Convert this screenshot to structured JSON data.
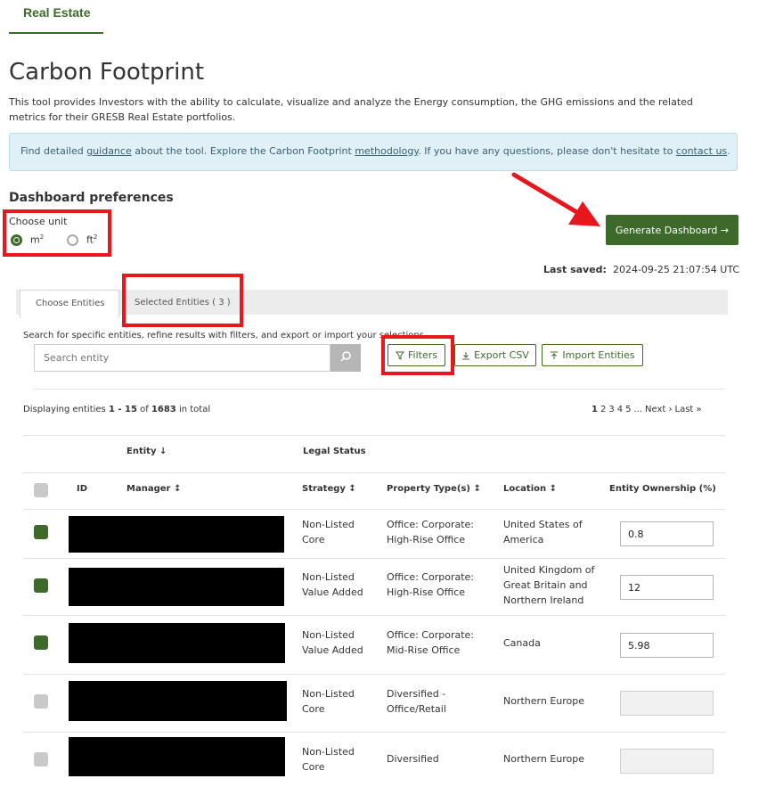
{
  "nav": {
    "tab_label": "Real Estate"
  },
  "page": {
    "title": "Carbon Footprint",
    "description": "This tool provides Investors with the ability to calculate, visualize and analyze the Energy consumption, the GHG emissions and the related metrics for their GRESB Real Estate portfolios.",
    "info": {
      "t1": "Find detailed ",
      "link_guidance": "guidance",
      "t2": " about the tool. Explore the Carbon Footprint ",
      "link_methodology": "methodology",
      "t3": ". If you have any questions, please don't hesitate to ",
      "link_contact": "contact us",
      "t4": "."
    }
  },
  "preferences": {
    "title": "Dashboard preferences",
    "unit_label": "Choose unit",
    "unit_m_base": "m",
    "unit_ft_base": "ft",
    "unit_exp": "2",
    "selected_unit": "m2"
  },
  "generate_button": {
    "label": "Generate Dashboard →"
  },
  "last_saved": {
    "label": "Last saved:",
    "value": "2024-09-25 21:07:54 UTC"
  },
  "tabs": [
    {
      "label": "Choose Entities",
      "active": true
    },
    {
      "label": "Selected Entities ( 3 )",
      "active": false
    }
  ],
  "search": {
    "hint": "Search for specific entities, refine results with filters, and export or import your selections",
    "placeholder": "Search entity"
  },
  "toolbar": {
    "filters_label": "Filters",
    "export_label": "Export CSV",
    "import_label": "Import Entities"
  },
  "display": {
    "prefix": "Displaying entities ",
    "range": "1 - 15",
    "mid": " of ",
    "total": "1683",
    "suffix": " in total"
  },
  "pagination": {
    "pages": [
      "1",
      "2",
      "3",
      "4",
      "5"
    ],
    "current": "1",
    "ellipsis": "...",
    "next": "Next ›",
    "last": "Last »"
  },
  "table": {
    "group_headers": {
      "entity": "Entity",
      "legal_status": "Legal Status"
    },
    "headers": {
      "id": "ID",
      "manager": "Manager",
      "strategy": "Strategy",
      "property_types": "Property Type(s)",
      "location": "Location",
      "ownership": "Entity Ownership (%)"
    },
    "rows": [
      {
        "checked": true,
        "strategy": [
          "Non-Listed",
          "Core"
        ],
        "property": [
          "Office: Corporate:",
          "High-Rise Office"
        ],
        "location": [
          "United States of",
          "America"
        ],
        "ownership": "0.8"
      },
      {
        "checked": true,
        "strategy": [
          "Non-Listed",
          "Value Added"
        ],
        "property": [
          "Office: Corporate:",
          "High-Rise Office"
        ],
        "location": [
          "United Kingdom of",
          "Great Britain and",
          "Northern Ireland"
        ],
        "ownership": "12"
      },
      {
        "checked": true,
        "strategy": [
          "Non-Listed",
          "Value Added"
        ],
        "property": [
          "Office: Corporate:",
          "Mid-Rise Office"
        ],
        "location": [
          "Canada"
        ],
        "ownership": "5.98"
      },
      {
        "checked": false,
        "strategy": [
          "Non-Listed",
          "Core"
        ],
        "property": [
          "Diversified -",
          "Office/Retail"
        ],
        "location": [
          "Northern Europe"
        ],
        "ownership": ""
      },
      {
        "checked": false,
        "strategy": [
          "Non-Listed",
          "Core"
        ],
        "property": [
          "Diversified"
        ],
        "location": [
          "Northern Europe"
        ],
        "ownership": ""
      }
    ]
  },
  "colors": {
    "brand": "#3d6a2a",
    "highlight": "#e8171d",
    "info_bg": "#dff0f7"
  }
}
